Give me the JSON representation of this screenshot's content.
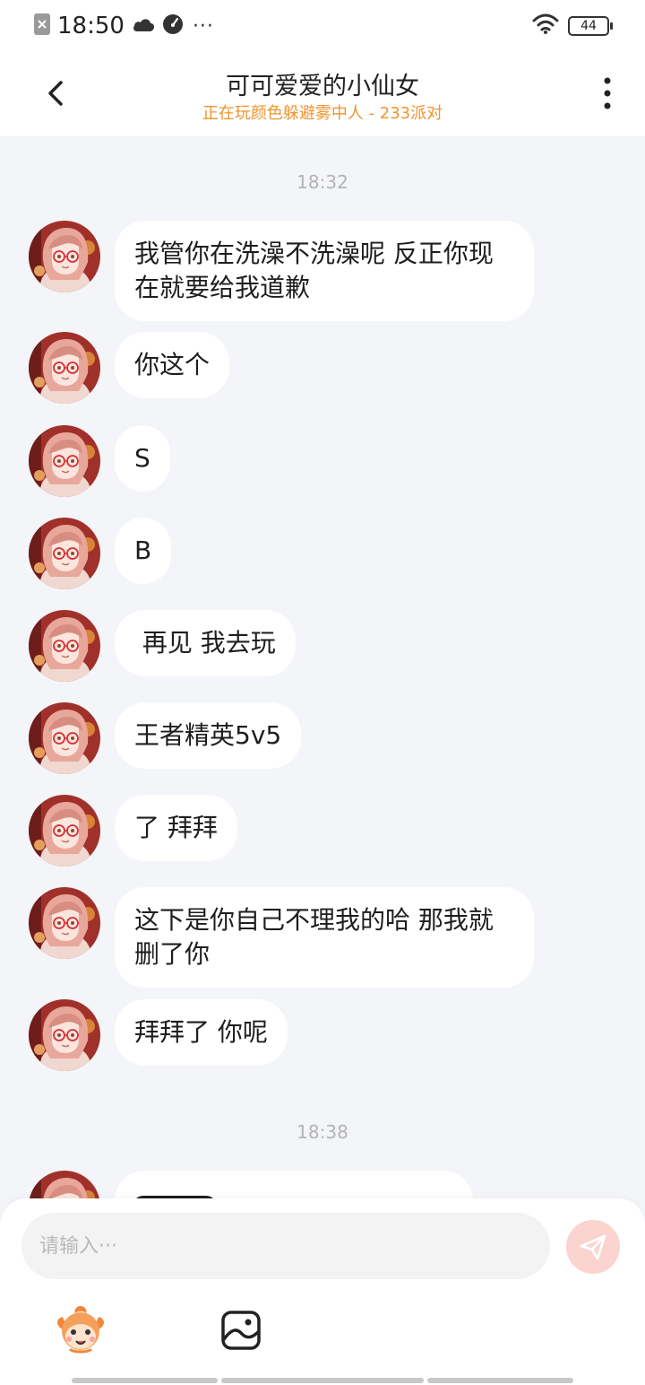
{
  "status_bar": {
    "time": "18:50",
    "battery": "44",
    "more": "···"
  },
  "header": {
    "title": "可可爱爱的小仙女",
    "subtitle": "正在玩颜色躲避雾中人 - 233派对"
  },
  "chat": {
    "divider_1": "18:32",
    "divider_2": "18:38",
    "messages": [
      {
        "text": "我管你在洗澡不洗澡呢 反正你现在就要给我道歉"
      },
      {
        "text": "你这个"
      },
      {
        "text": "S"
      },
      {
        "text": "B"
      },
      {
        "text": " 再见 我去玩"
      },
      {
        "text": "王者精英5v5"
      },
      {
        "text": "了 拜拜"
      },
      {
        "text": "这下是你自己不理我的哈 那我就删了你"
      },
      {
        "text": "拜拜了 你呢"
      }
    ]
  },
  "input": {
    "placeholder": "请输入···"
  },
  "icons": {
    "emoji": "emoji-mascot-icon",
    "image": "image-icon",
    "send": "send-icon"
  },
  "colors": {
    "accent_subtitle": "#f0942e",
    "background": "#f4f5f9",
    "send_button": "#fbd3cf"
  }
}
